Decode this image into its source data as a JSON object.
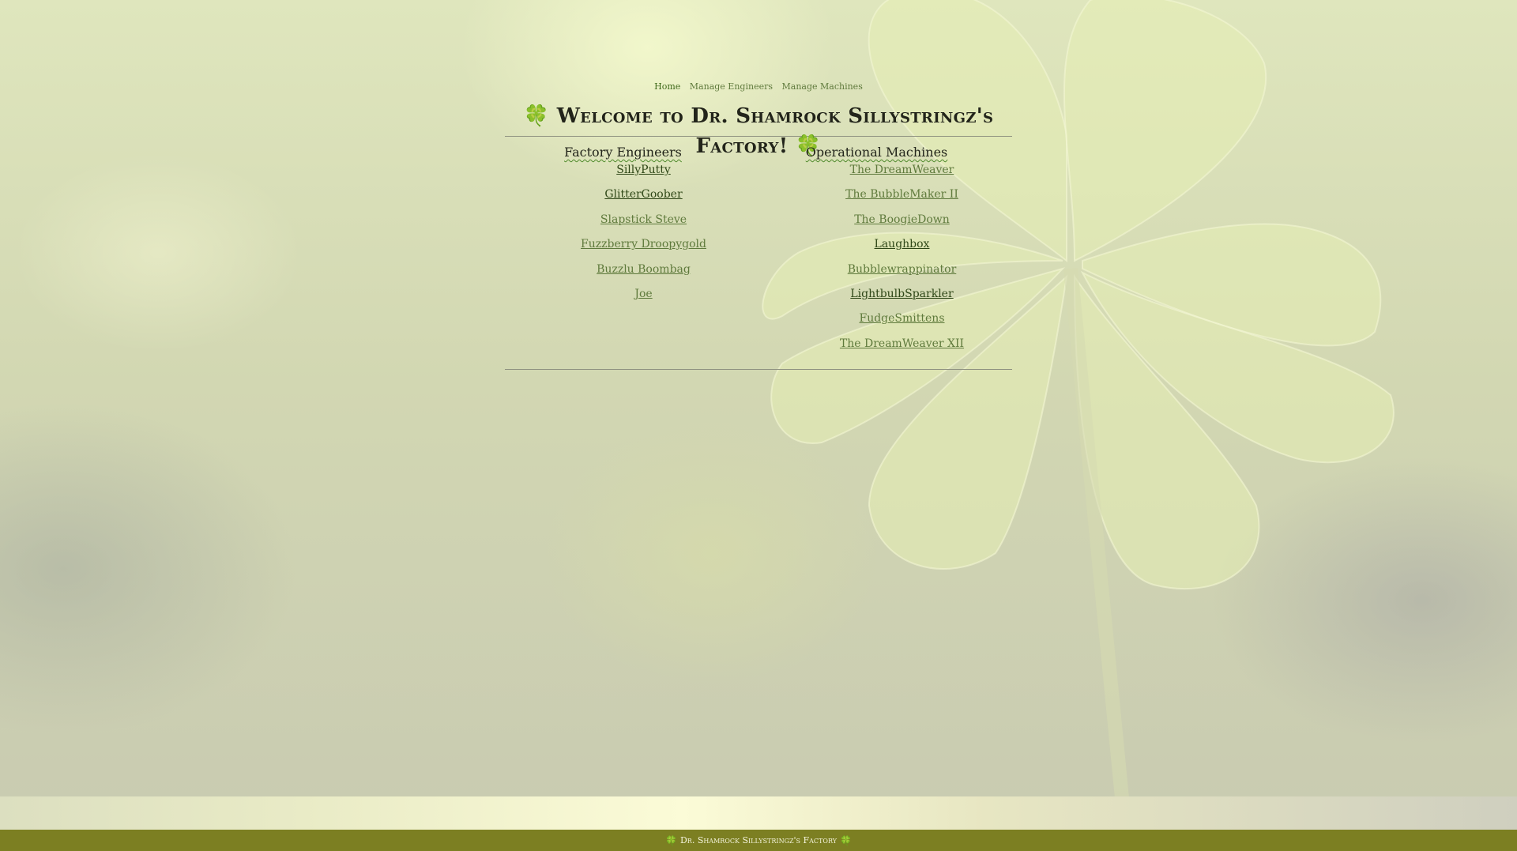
{
  "nav": {
    "items": [
      {
        "label": "Home"
      },
      {
        "label": "Manage Engineers"
      },
      {
        "label": "Manage Machines"
      }
    ]
  },
  "header": {
    "clover_glyph": "🍀",
    "title": "Welcome to Dr. Shamrock Sillystringz's Factory!"
  },
  "engineers": {
    "heading": "Factory Engineers",
    "items": [
      {
        "label": "SillyPutty"
      },
      {
        "label": "GlitterGoober"
      },
      {
        "label": "Slapstick Steve"
      },
      {
        "label": "Fuzzberry Droopygold"
      },
      {
        "label": "Buzzlu Boombag"
      },
      {
        "label": "Joe"
      }
    ]
  },
  "machines": {
    "heading": "Operational Machines",
    "items": [
      {
        "label": "The DreamWeaver"
      },
      {
        "label": "The BubbleMaker II"
      },
      {
        "label": "The BoogieDown"
      },
      {
        "label": "Laughbox"
      },
      {
        "label": "Bubblewrappinator"
      },
      {
        "label": "LightbulbSparkler"
      },
      {
        "label": "FudgeSmittens"
      },
      {
        "label": "The DreamWeaver XII"
      }
    ]
  },
  "footer": {
    "text": "Dr. Shamrock Sillystringz's Factory"
  },
  "colors": {
    "link": "#5f7a3c",
    "link_visited": "#2f4717",
    "footer_bg": "#7c7f22",
    "background": "#d8ddb8"
  }
}
